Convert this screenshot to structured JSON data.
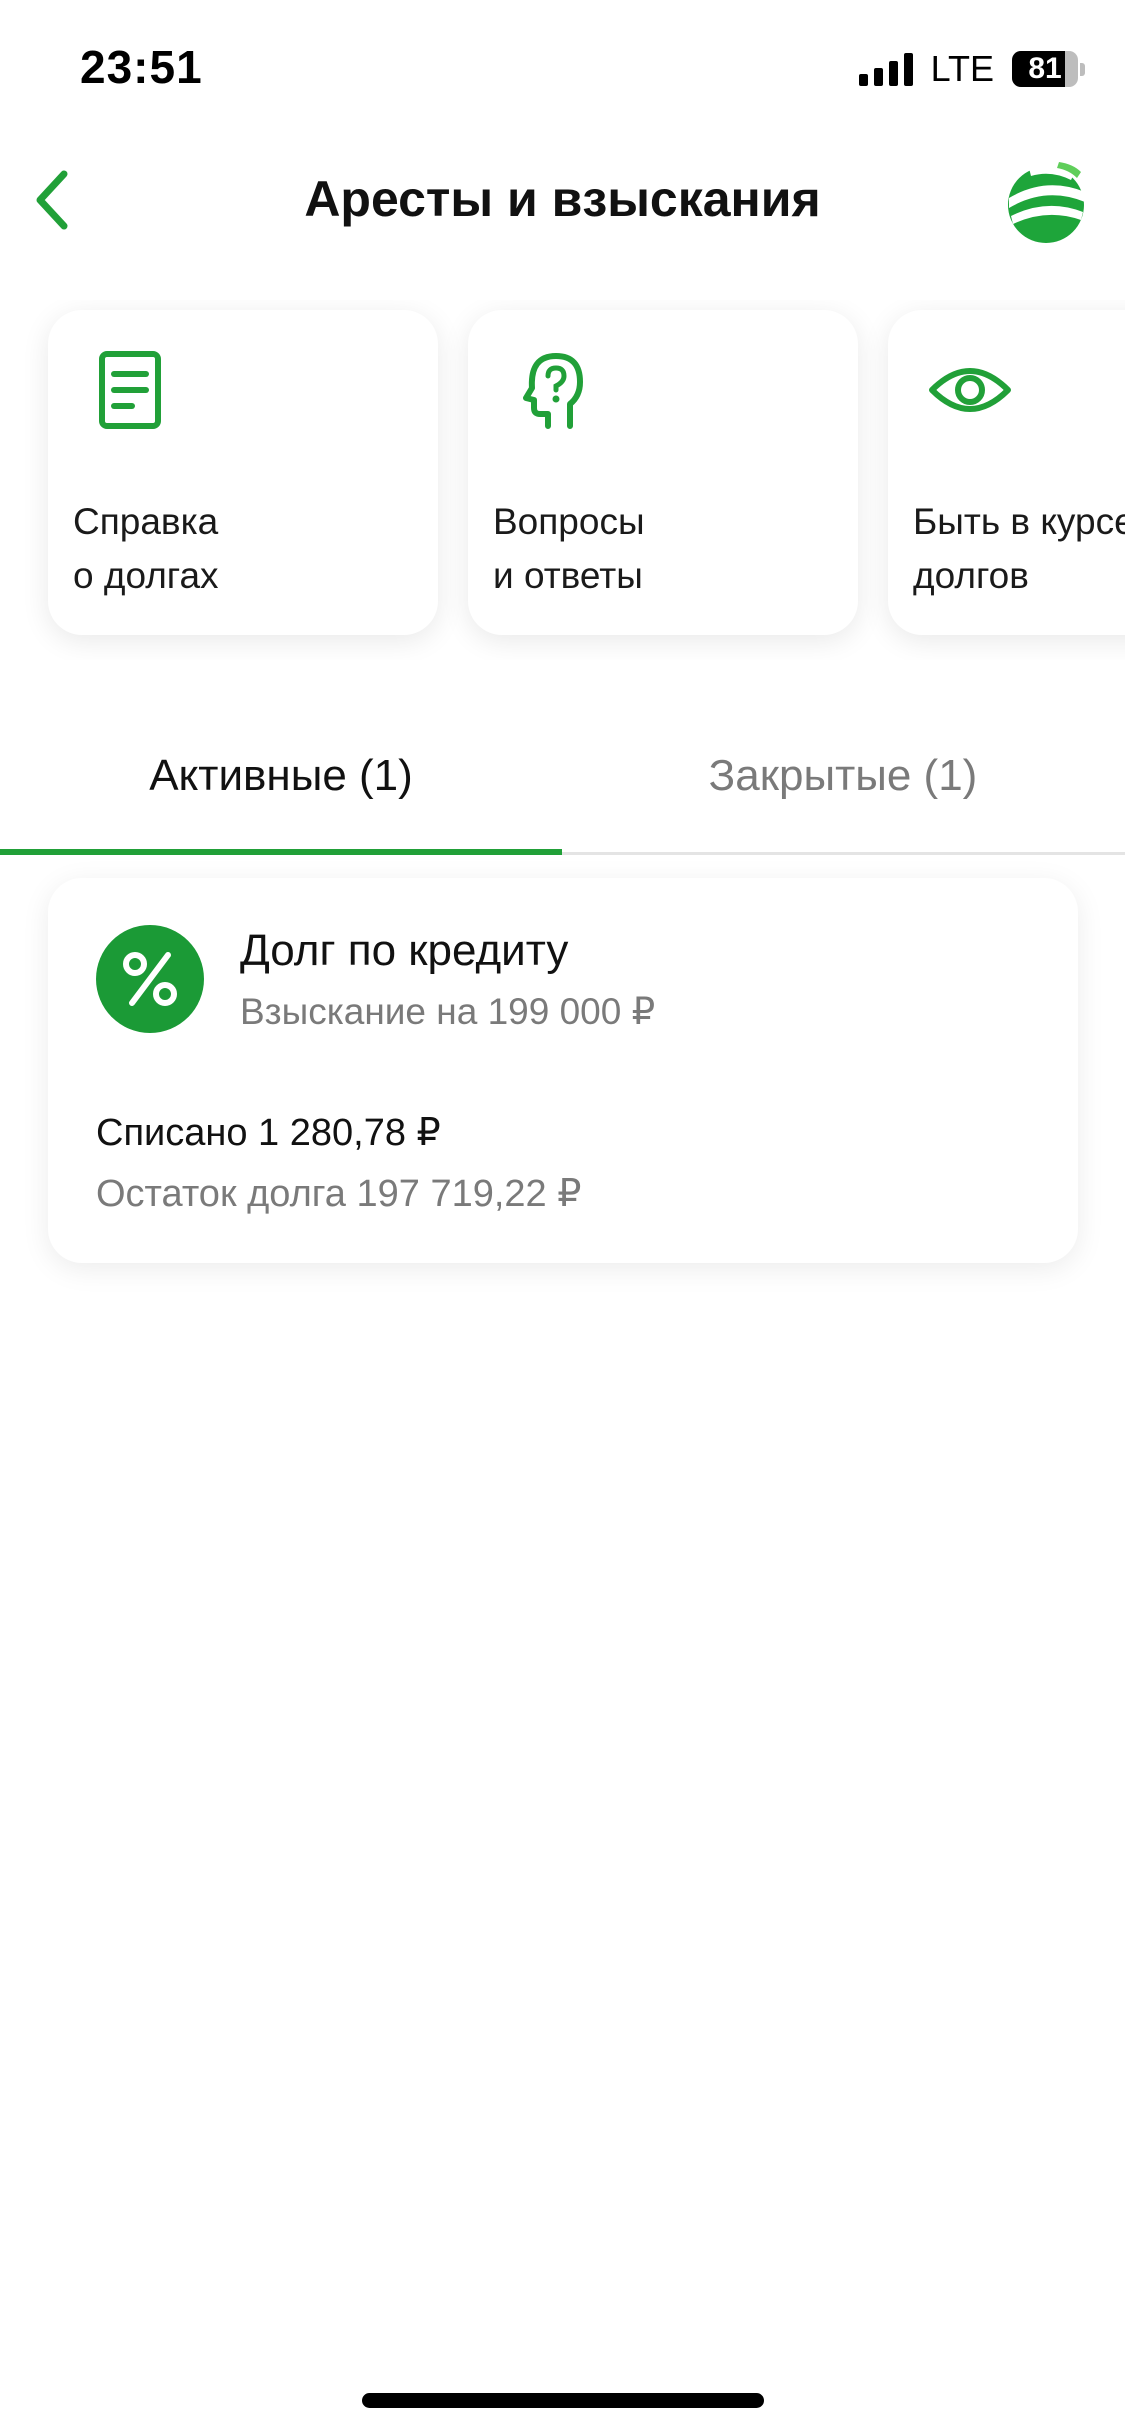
{
  "status_bar": {
    "time": "23:51",
    "network": "LTE",
    "battery": "81",
    "battery_level": 0.81
  },
  "header": {
    "title": "Аресты и взыскания",
    "back_icon": "chevron-left-icon",
    "logo": "sber-logo"
  },
  "quick_actions": [
    {
      "label": "Справка\nо долгах",
      "icon": "document-icon"
    },
    {
      "label": "Вопросы\nи ответы",
      "icon": "head-question-icon"
    },
    {
      "label": "Быть в курсе\nдолгов",
      "icon": "eye-icon"
    }
  ],
  "tabs": [
    {
      "label": "Активные (1)",
      "active": true
    },
    {
      "label": "Закрытые (1)",
      "active": false
    }
  ],
  "debt_card": {
    "icon": "percent-icon",
    "title": "Долг по кредиту",
    "subtitle": "Взыскание на 199 000 ₽",
    "written_off": "Списано 1 280,78 ₽",
    "remainder": "Остаток долга 197 719,22 ₽"
  },
  "colors": {
    "accent": "#21a038",
    "icon_bg": "#1b9a36",
    "text_primary": "#111111",
    "text_secondary": "#7a7a7a"
  }
}
